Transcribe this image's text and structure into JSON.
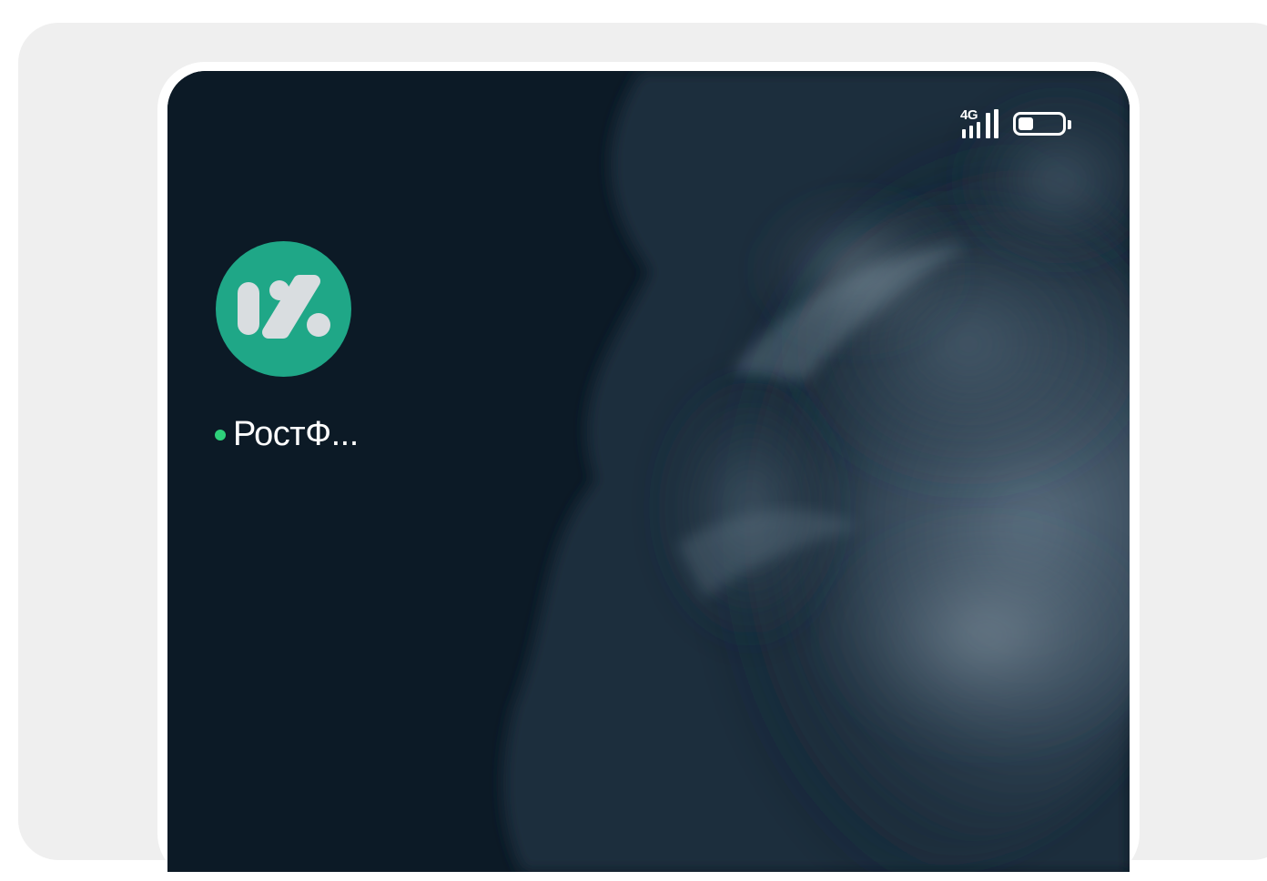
{
  "status_bar": {
    "network_type": "4G",
    "signal_icon": "signal-bars-icon",
    "battery_icon": "battery-icon",
    "battery_level": 0.35
  },
  "home_screen": {
    "apps": [
      {
        "label": "РостФ...",
        "icon": "percent-logo-icon",
        "icon_color": "#1fa787",
        "has_notification_dot": true,
        "notification_dot_color": "#2ed07a"
      }
    ]
  },
  "colors": {
    "page_background": "#efefef",
    "screen_background": "#0c1a26"
  }
}
